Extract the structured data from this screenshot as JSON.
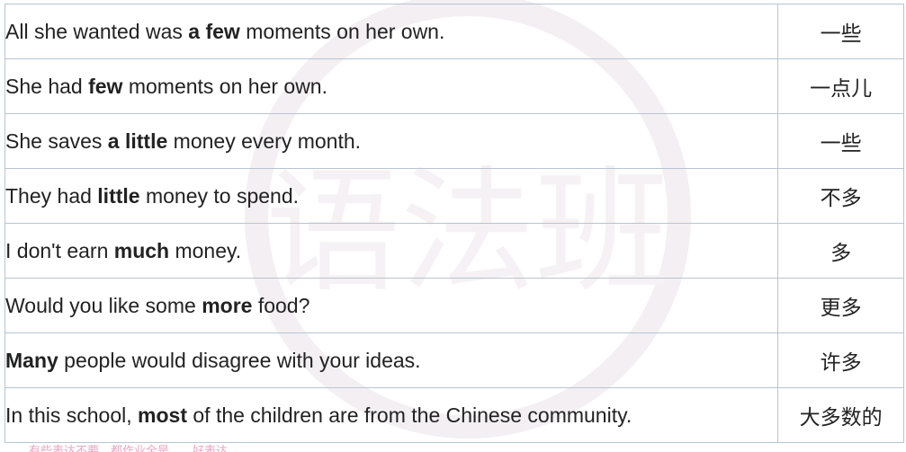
{
  "rows": [
    {
      "pre": "All she wanted was ",
      "bold": "a few",
      "post": " moments on her own.",
      "zh": "一些"
    },
    {
      "pre": "She had ",
      "bold": "few",
      "post": " moments on her own.",
      "zh": "一点儿"
    },
    {
      "pre": "She saves ",
      "bold": "a little",
      "post": " money every month.",
      "zh": "一些"
    },
    {
      "pre": "They had ",
      "bold": "little",
      "post": " money to spend.",
      "zh": "不多"
    },
    {
      "pre": "I don't earn ",
      "bold": "much",
      "post": " money.",
      "zh": "多"
    },
    {
      "pre": "Would you like some ",
      "bold": "more",
      "post": " food?",
      "zh": "更多"
    },
    {
      "pre": "",
      "bold": "Many",
      "post": " people would disagree with your ideas.",
      "zh": "许多"
    },
    {
      "pre": "In this school, ",
      "bold": "most",
      "post": " of the children are from the Chinese community.",
      "zh": "大多数的"
    }
  ],
  "watermark": {
    "text": "语法班",
    "color": "#f3eff2"
  },
  "footer": {
    "text": "有些表达不要…都作业全是…，好表达"
  },
  "colors": {
    "border": "#b8c4d2",
    "text": "#222222",
    "footer": "#e6a6c4"
  }
}
